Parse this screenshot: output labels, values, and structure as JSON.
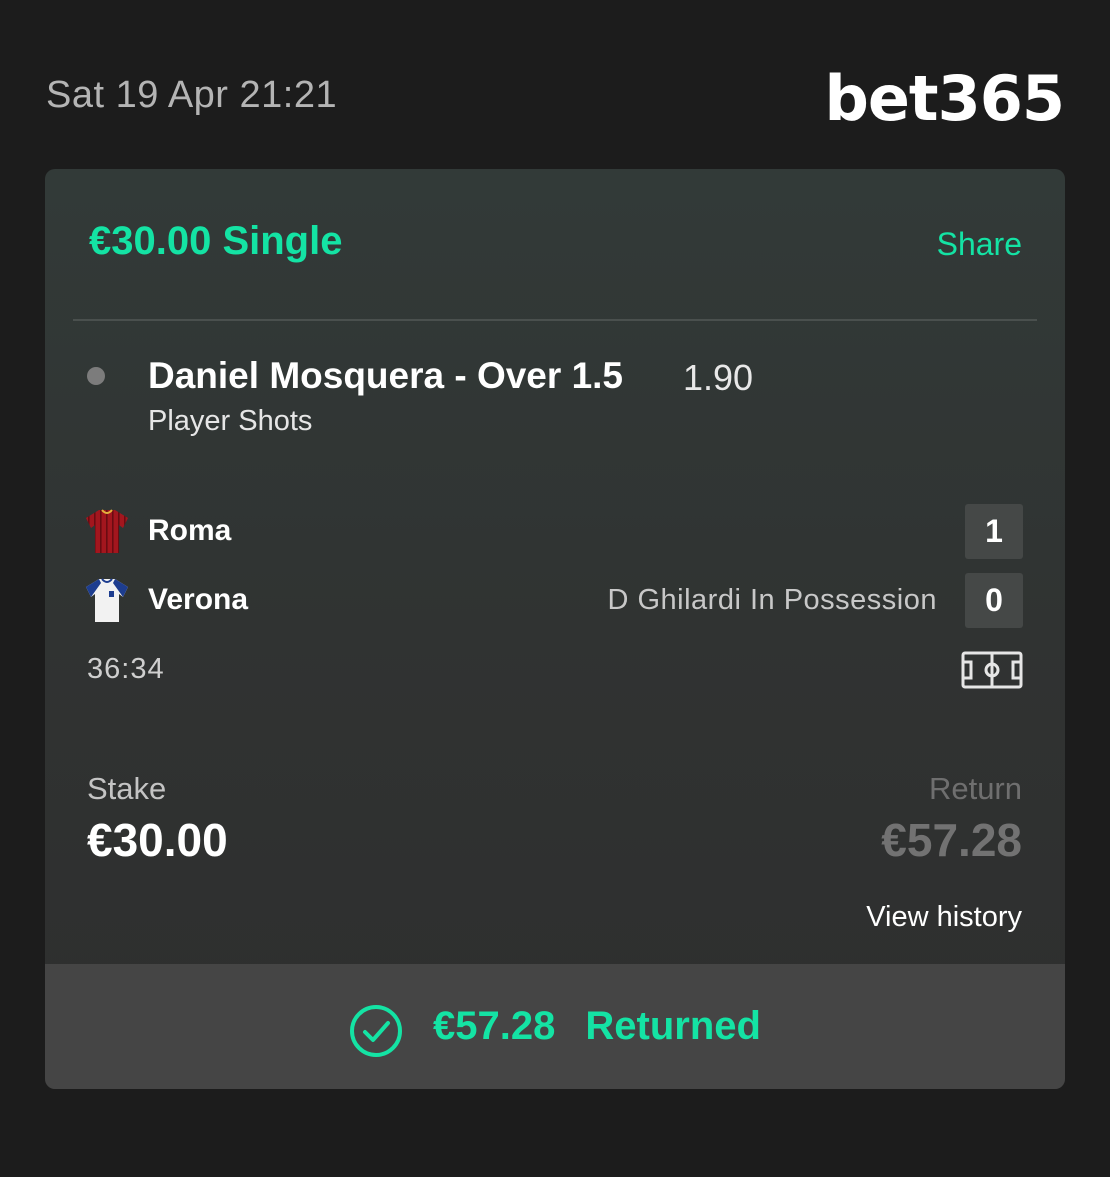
{
  "header": {
    "datetime": "Sat 19 Apr 21:21",
    "logo_text": "bet365"
  },
  "bet": {
    "title": "€30.00 Single",
    "share_label": "Share",
    "selection": "Daniel Mosquera - Over 1.5",
    "odds": "1.90",
    "market": "Player Shots"
  },
  "match": {
    "home": {
      "name": "Roma",
      "score": "1",
      "kit_icon": "roma-kit-icon"
    },
    "away": {
      "name": "Verona",
      "score": "0",
      "kit_icon": "verona-kit-icon"
    },
    "possession_text": "D Ghilardi In Possession",
    "clock": "36:34",
    "pitch_icon": "pitch-icon"
  },
  "summary": {
    "stake_label": "Stake",
    "stake_value": "€30.00",
    "return_label": "Return",
    "return_value": "€57.28",
    "view_history_label": "View history"
  },
  "footer": {
    "returned_amount": "€57.28",
    "returned_label": "Returned",
    "status_icon": "check-circle-icon"
  },
  "colors": {
    "accent": "#14e3a4",
    "background": "#1c1c1c",
    "card": "#313634",
    "footer": "#454545"
  }
}
